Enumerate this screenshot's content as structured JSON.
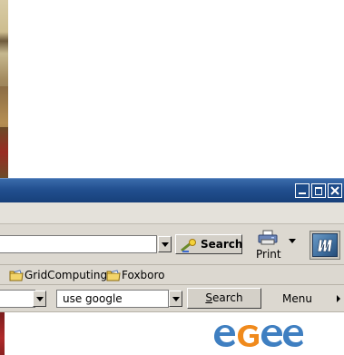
{
  "titlebar": {
    "minimize_icon": "minimize-icon",
    "maximize_icon": "maximize-icon",
    "close_icon": "close-icon"
  },
  "navbar": {
    "url_value": "",
    "search_label": "Search",
    "print_label": "Print"
  },
  "bookmarks": [
    {
      "label": "GridComputing",
      "icon": "folder-icon"
    },
    {
      "label": "Foxboro",
      "icon": "folder-icon"
    }
  ],
  "searchbar": {
    "engine_value": "use google",
    "search_button_label": "Search",
    "search_button_accel": "S",
    "search_button_rest": "earch",
    "menu_label": "Menu"
  },
  "content": {
    "logo_text": "eGee"
  },
  "colors": {
    "title_bar": "#224f8f",
    "chrome": "#d4d0c8",
    "logo_blue": "#3f7fc1",
    "logo_orange": "#f08a1c"
  }
}
